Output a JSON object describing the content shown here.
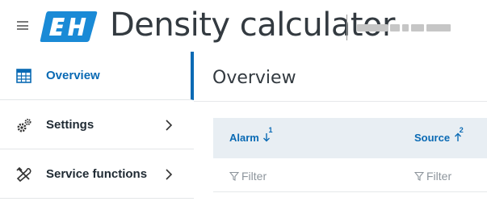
{
  "header": {
    "app_title": "Density calculator",
    "brand_color": "#1a8ad6",
    "accent_color": "#0a6ab4"
  },
  "sidebar": {
    "items": [
      {
        "label": "Overview",
        "icon": "grid-table-icon",
        "active": true
      },
      {
        "label": "Settings",
        "icon": "gears-icon",
        "active": false
      },
      {
        "label": "Service functions",
        "icon": "wrench-screwdriver-icon",
        "active": false
      }
    ]
  },
  "main": {
    "page_title": "Overview",
    "table": {
      "columns": [
        {
          "label": "Alarm",
          "sort_direction": "descending",
          "sort_order": "1"
        },
        {
          "label": "Source",
          "sort_direction": "ascending",
          "sort_order": "2"
        }
      ],
      "filters": [
        {
          "placeholder": "Filter"
        },
        {
          "placeholder": "Filter"
        }
      ]
    }
  }
}
